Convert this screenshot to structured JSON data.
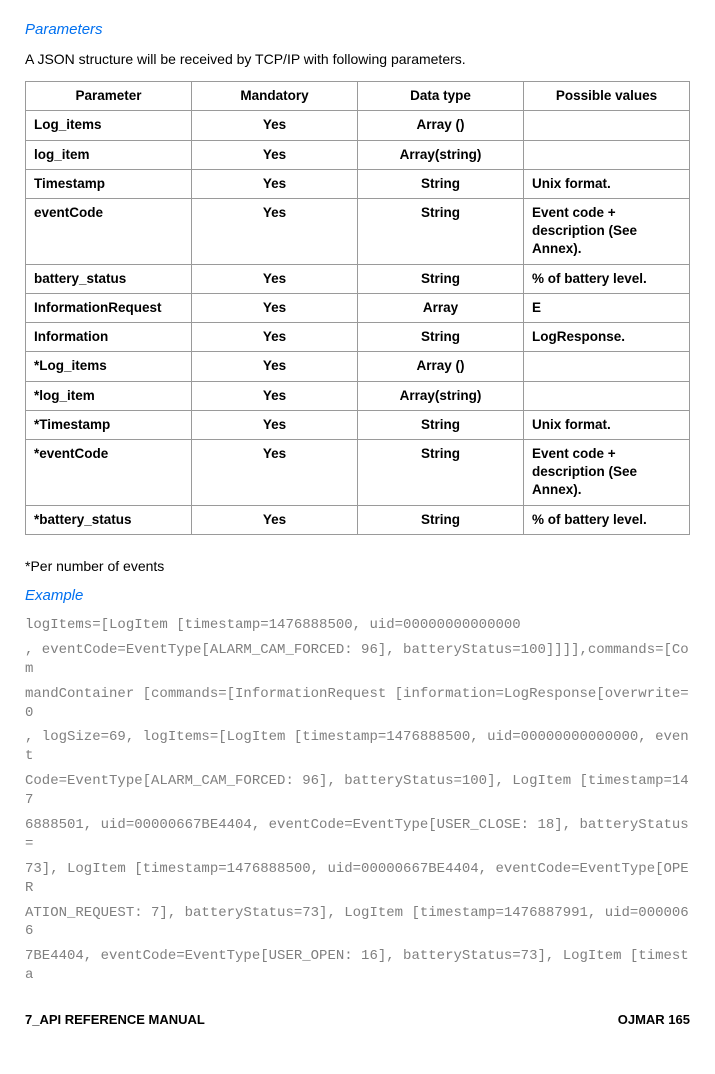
{
  "headings": {
    "parameters": "Parameters",
    "example": "Example"
  },
  "intro": "A JSON structure will be received by TCP/IP with following parameters.",
  "table": {
    "headers": {
      "parameter": "Parameter",
      "mandatory": "Mandatory",
      "datatype": "Data type",
      "possible": "Possible values"
    },
    "rows": [
      {
        "param": "Log_items",
        "mand": "Yes",
        "dtype": "Array ()",
        "poss": ""
      },
      {
        "param": "log_item",
        "mand": "Yes",
        "dtype": "Array(string)",
        "poss": ""
      },
      {
        "param": "Timestamp",
        "mand": "Yes",
        "dtype": "String",
        "poss": "Unix format."
      },
      {
        "param": "eventCode",
        "mand": "Yes",
        "dtype": "String",
        "poss": "Event code + description (See Annex)."
      },
      {
        "param": "battery_status",
        "mand": "Yes",
        "dtype": "String",
        "poss": "% of battery level."
      },
      {
        "param": "InformationRequest",
        "mand": "Yes",
        "dtype": "Array",
        "poss": "E"
      },
      {
        "param": "Information",
        "mand": "Yes",
        "dtype": "String",
        "poss": "LogResponse."
      },
      {
        "param": "*Log_items",
        "mand": "Yes",
        "dtype": "Array ()",
        "poss": ""
      },
      {
        "param": "*log_item",
        "mand": "Yes",
        "dtype": "Array(string)",
        "poss": ""
      },
      {
        "param": "*Timestamp",
        "mand": "Yes",
        "dtype": "String",
        "poss": "Unix format."
      },
      {
        "param": "*eventCode",
        "mand": "Yes",
        "dtype": "String",
        "poss": "Event code + description (See Annex)."
      },
      {
        "param": "*battery_status",
        "mand": "Yes",
        "dtype": "String",
        "poss": "% of battery level."
      }
    ]
  },
  "note": "*Per number of events",
  "example_lines": [
    "logItems=[LogItem [timestamp=1476888500, uid=00000000000000",
    ", eventCode=EventType[ALARM_CAM_FORCED: 96], batteryStatus=100]]]],commands=[Com",
    "mandContainer [commands=[InformationRequest [information=LogResponse[overwrite=0",
    ", logSize=69, logItems=[LogItem [timestamp=1476888500, uid=00000000000000, event",
    "Code=EventType[ALARM_CAM_FORCED: 96], batteryStatus=100], LogItem [timestamp=147",
    "6888501, uid=00000667BE4404, eventCode=EventType[USER_CLOSE: 18], batteryStatus=",
    "73], LogItem [timestamp=1476888500, uid=00000667BE4404, eventCode=EventType[OPER",
    "ATION_REQUEST: 7], batteryStatus=73], LogItem [timestamp=1476887991, uid=0000066",
    "7BE4404, eventCode=EventType[USER_OPEN: 16], batteryStatus=73], LogItem [timesta"
  ],
  "footer": {
    "left": "7_API REFERENCE MANUAL",
    "right": "OJMAR 165"
  }
}
